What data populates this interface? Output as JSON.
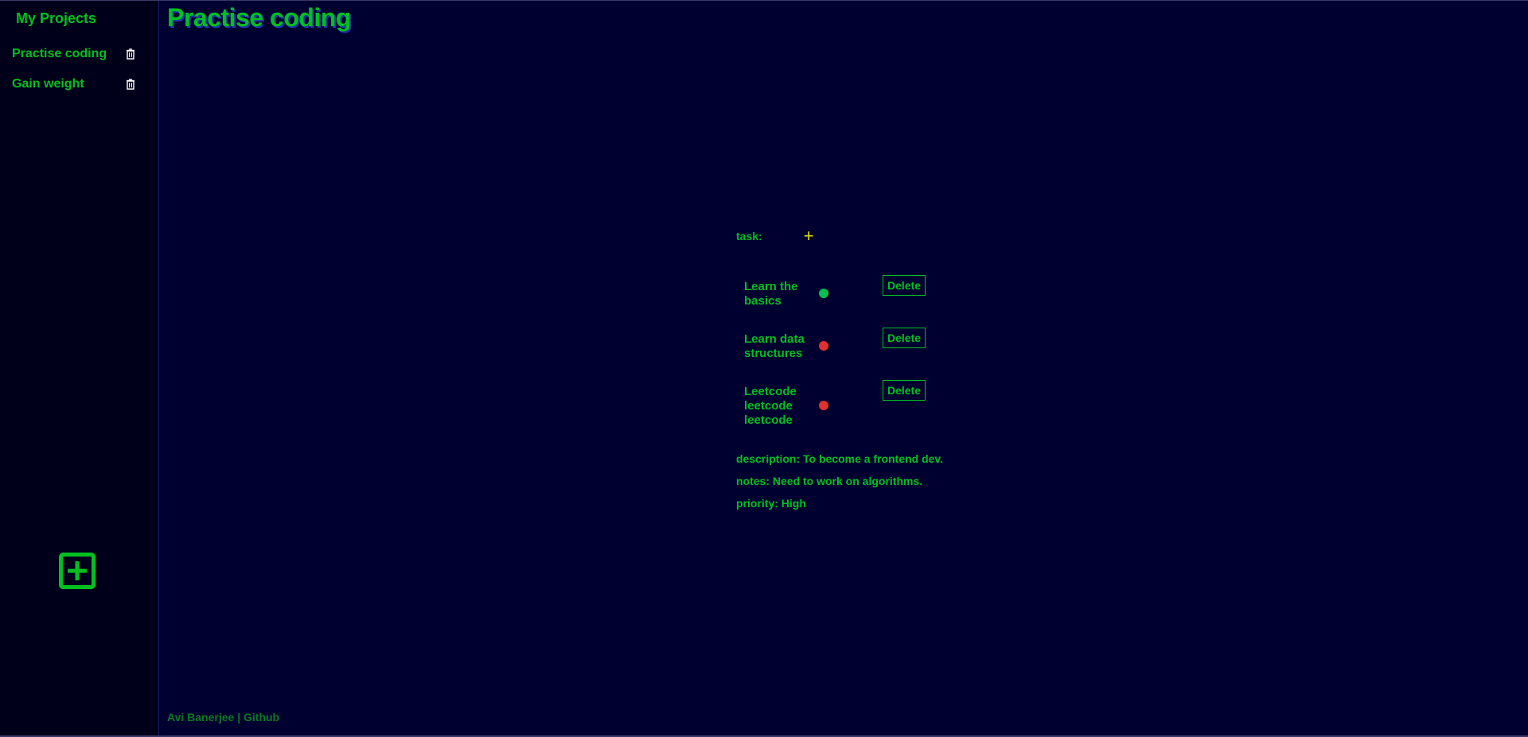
{
  "sidebar": {
    "title": "My Projects",
    "projects": [
      {
        "label": "Practise coding",
        "icon": "trash-icon"
      },
      {
        "label": "Gain weight",
        "icon": "trash-icon"
      }
    ],
    "add_icon": "plus-square-icon"
  },
  "main": {
    "title": "Practise coding",
    "task_label": "task:",
    "add_task_glyph": "+",
    "tasks": [
      {
        "name": "Learn the basics",
        "status_color": "#00c050",
        "delete_label": "Delete"
      },
      {
        "name": "Learn data structures",
        "status_color": "#e03030",
        "delete_label": "Delete"
      },
      {
        "name": "Leetcode leetcode leetcode",
        "status_color": "#e03030",
        "delete_label": "Delete"
      }
    ],
    "description": "description: To become a frontend dev.",
    "notes": "notes: Need to work on algorithms.",
    "priority": "priority: High"
  },
  "footer": {
    "author": "Avi Banerjee",
    "separator": "|",
    "link": "Github"
  },
  "colors": {
    "background": "#000030",
    "sidebar_bg": "#00001a",
    "accent": "#00c020",
    "add_task": "#e0e000"
  }
}
